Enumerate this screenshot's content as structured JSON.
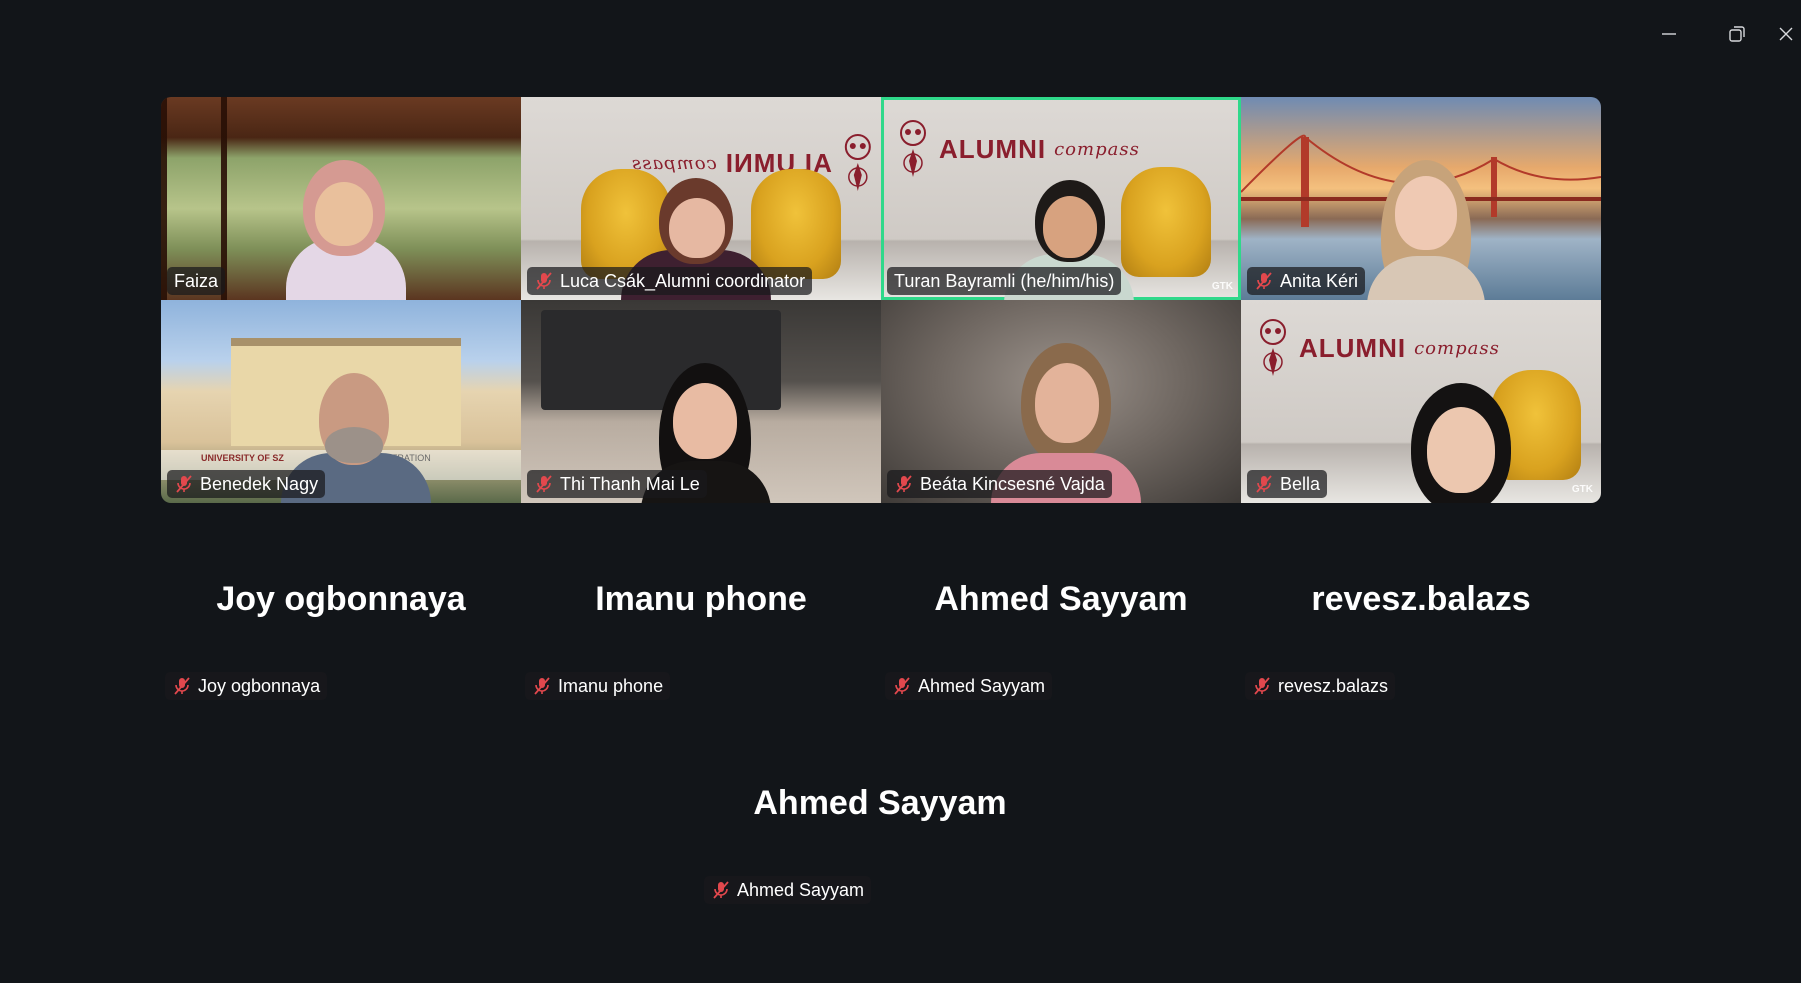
{
  "window_controls": {
    "minimize_icon": "minimize-icon",
    "restore_icon": "restore-icon",
    "close_icon": "close-icon"
  },
  "video_tiles": [
    {
      "name": "Faiza",
      "muted": false,
      "active": false,
      "background": "window"
    },
    {
      "name": "Luca Csák_Alumni coordinator",
      "muted": true,
      "active": false,
      "background": "alumni"
    },
    {
      "name": "Turan Bayramli (he/him/his)",
      "muted": false,
      "active": true,
      "background": "alumni"
    },
    {
      "name": "Anita Kéri",
      "muted": true,
      "active": false,
      "background": "bridge"
    },
    {
      "name": "Benedek Nagy",
      "muted": true,
      "active": false,
      "background": "university"
    },
    {
      "name": "Thi Thanh Mai Le",
      "muted": true,
      "active": false,
      "background": "home"
    },
    {
      "name": "Beáta Kincsesné Vajda",
      "muted": true,
      "active": false,
      "background": "blur"
    },
    {
      "name": "Bella",
      "muted": true,
      "active": false,
      "background": "alumni"
    }
  ],
  "alumni_background": {
    "word": "ALUMNI",
    "script": "compass",
    "badge": "GTK"
  },
  "university_background_text": [
    "UNIVERSITY OF SZ",
    "S ADMINISTRATION"
  ],
  "audio_tiles": [
    {
      "display_name": "Joy ogbonnaya",
      "tag": "Joy ogbonnaya",
      "muted": true
    },
    {
      "display_name": "Imanu phone",
      "tag": "Imanu phone",
      "muted": true
    },
    {
      "display_name": "Ahmed Sayyam",
      "tag": "Ahmed Sayyam",
      "muted": true
    },
    {
      "display_name": "revesz.balazs",
      "tag": "revesz.balazs",
      "muted": true
    }
  ],
  "audio_single": {
    "display_name": "Ahmed Sayyam",
    "tag": "Ahmed Sayyam",
    "muted": true
  },
  "colors": {
    "background": "#121519",
    "active_speaker_border": "#2fd88a",
    "mute_icon": "#e2484d",
    "alumni_brand": "#8a1e2d"
  }
}
